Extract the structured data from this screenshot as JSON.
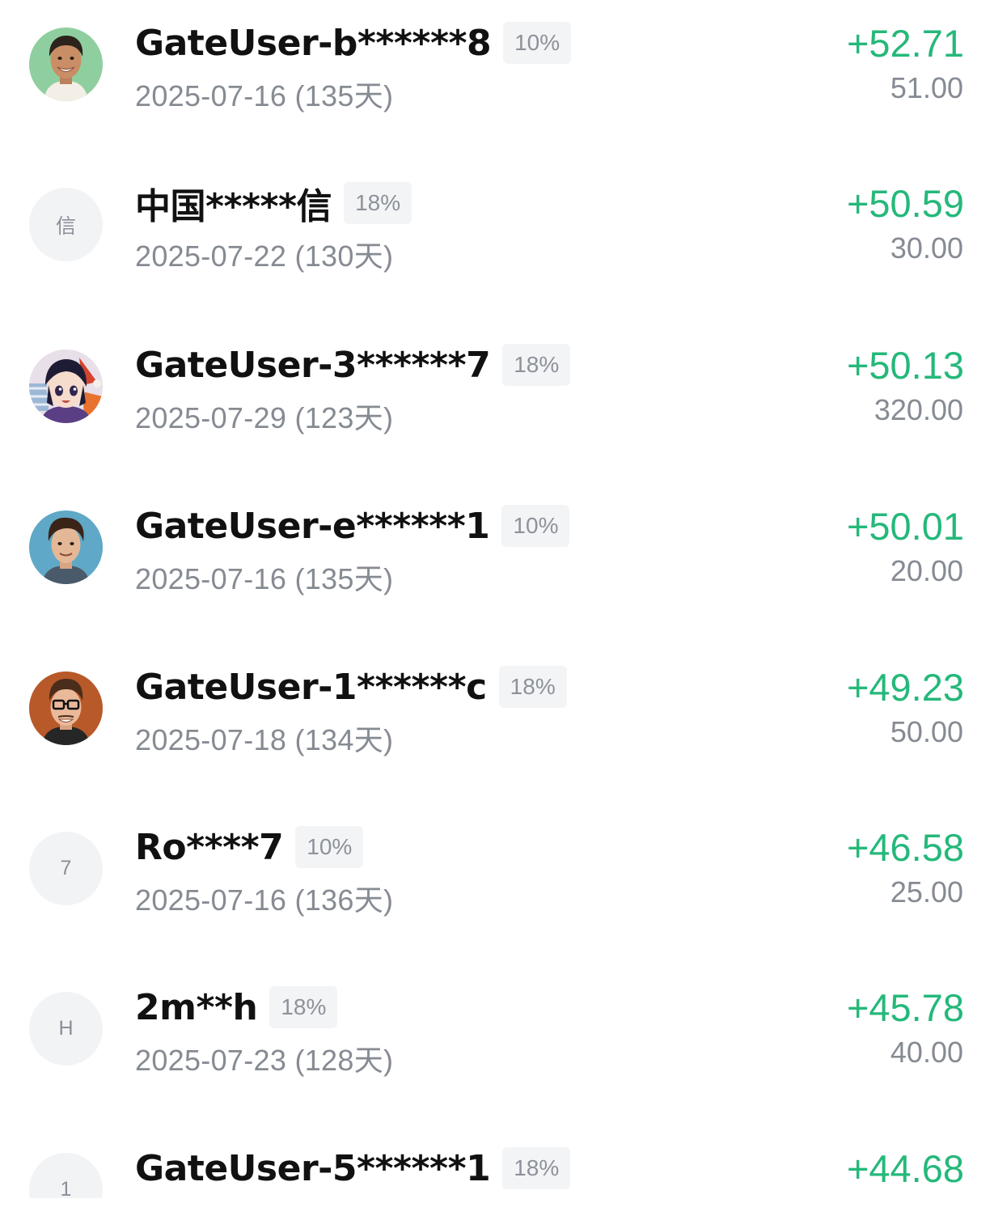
{
  "rows": [
    {
      "avatar_type": "photo",
      "avatar_icon": "avatar-man-smiling-green-bg",
      "name": "GateUser-b******8",
      "rate": "10%",
      "date": "2025-07-16 (135天)",
      "profit": "+52.71",
      "amount": "51.00"
    },
    {
      "avatar_type": "initial",
      "avatar_initial": "信",
      "name": "中国*****信",
      "rate": "18%",
      "date": "2025-07-22 (130天)",
      "profit": "+50.59",
      "amount": "30.00"
    },
    {
      "avatar_type": "photo",
      "avatar_icon": "avatar-anime-character",
      "name": "GateUser-3******7",
      "rate": "18%",
      "date": "2025-07-29 (123天)",
      "profit": "+50.13",
      "amount": "320.00"
    },
    {
      "avatar_type": "photo",
      "avatar_icon": "avatar-man-blue-bg",
      "name": "GateUser-e******1",
      "rate": "10%",
      "date": "2025-07-16 (135天)",
      "profit": "+50.01",
      "amount": "20.00"
    },
    {
      "avatar_type": "photo",
      "avatar_icon": "avatar-man-glasses-orange-bg",
      "name": "GateUser-1******c",
      "rate": "18%",
      "date": "2025-07-18 (134天)",
      "profit": "+49.23",
      "amount": "50.00"
    },
    {
      "avatar_type": "initial",
      "avatar_initial": "7",
      "name": "Ro****7",
      "rate": "10%",
      "date": "2025-07-16 (136天)",
      "profit": "+46.58",
      "amount": "25.00"
    },
    {
      "avatar_type": "initial",
      "avatar_initial": "H",
      "name": "2m**h",
      "rate": "18%",
      "date": "2025-07-23 (128天)",
      "profit": "+45.78",
      "amount": "40.00"
    },
    {
      "avatar_type": "initial",
      "avatar_initial": "1",
      "name": "GateUser-5******1",
      "rate": "18%",
      "date": "",
      "profit": "+44.68",
      "amount": ""
    }
  ],
  "colors": {
    "profit": "#25b87a",
    "muted": "#868b93",
    "name": "#111111",
    "badge_bg": "#f3f4f6"
  }
}
